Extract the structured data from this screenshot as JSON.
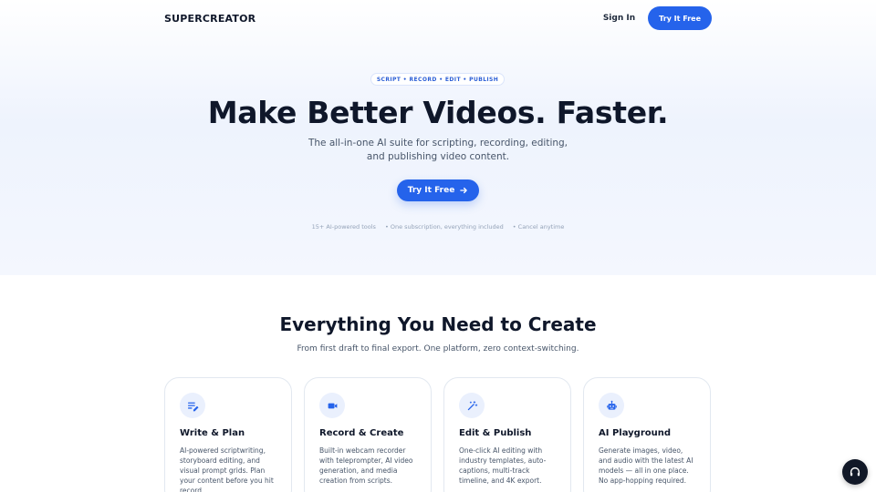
{
  "nav": {
    "brand": "SUPERCREATOR",
    "signin_label": "Sign In",
    "cta_label": "Try It Free"
  },
  "hero": {
    "eyebrow": "SCRIPT • RECORD • EDIT • PUBLISH",
    "title": "Make Better Videos. Faster.",
    "subtitle": "The all-in-one AI suite for scripting, recording, editing, and publishing video content.",
    "cta_label": "Try It Free",
    "stats": [
      "15+ AI-powered tools",
      "• One subscription, everything included",
      "• Cancel anytime"
    ]
  },
  "features": {
    "title": "Everything You Need to Create",
    "subtitle": "From first draft to final export. One platform, zero context-switching.",
    "cards": [
      {
        "icon": "edit-note-icon",
        "title": "Write & Plan",
        "desc": "AI-powered scriptwriting, storyboard editing, and visual prompt grids. Plan your content before you hit record."
      },
      {
        "icon": "video-camera-icon",
        "title": "Record & Create",
        "desc": "Built-in webcam recorder with teleprompter, AI video generation, and media creation from scripts."
      },
      {
        "icon": "magic-wand-icon",
        "title": "Edit & Publish",
        "desc": "One-click AI editing with industry templates, auto-captions, multi-track timeline, and 4K export."
      },
      {
        "icon": "robot-icon",
        "title": "AI Playground",
        "desc": "Generate images, video, and audio with the latest AI models — all in one place. No app-hopping required."
      }
    ]
  },
  "colors": {
    "accent": "#2563eb",
    "text": "#0f172a",
    "muted": "#475569",
    "icon_bg": "#eaf0fd",
    "support_bg": "#111827"
  },
  "support": {
    "icon": "headset-icon"
  }
}
